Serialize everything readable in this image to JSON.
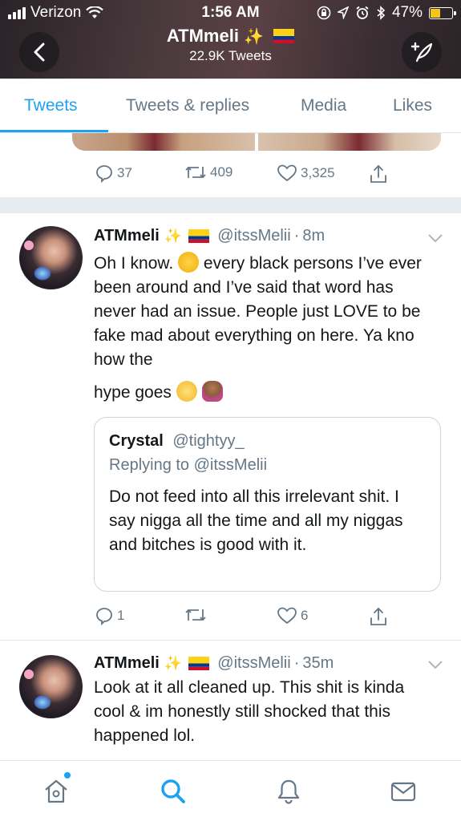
{
  "status_bar": {
    "carrier": "Verizon",
    "time": "1:56 AM",
    "battery_percent": "47%",
    "battery_level": 0.47,
    "battery_color": "#f5c518"
  },
  "header": {
    "name": "ATMmeli",
    "tweet_count": "22.9K Tweets",
    "back_icon": "chevron-left-icon",
    "compose_icon": "compose-feather-icon"
  },
  "tabs": [
    {
      "label": "Tweets",
      "active": true
    },
    {
      "label": "Tweets & replies",
      "active": false
    },
    {
      "label": "Media",
      "active": false
    },
    {
      "label": "Likes",
      "active": false
    }
  ],
  "colors": {
    "accent": "#1da1f2",
    "secondary_text": "#657786",
    "border": "#e1e8ed"
  },
  "previous_tweet": {
    "replies": "37",
    "retweets": "409",
    "likes": "3,325"
  },
  "tweets": [
    {
      "name": "ATMmeli",
      "handle": "@itssMelii",
      "time": "8m",
      "text_line1": "Oh I know.",
      "text_line1_rest": "every black persons I’ve ever been around and I’ve said that word has never had an issue. People just LOVE to be fake mad about everything on here. Ya kno how the",
      "text_end": "hype goes",
      "quote": {
        "name": "Crystal",
        "handle": "@tightyy_",
        "replying_to": "Replying to @itssMelii",
        "text": "Do not feed into all this irrelevant shit. I say nigga all the time and all my niggas and bitches is good with it."
      },
      "replies": "1",
      "retweets": "",
      "likes": "6"
    },
    {
      "name": "ATMmeli",
      "handle": "@itssMelii",
      "time": "35m",
      "text": "Look at it all cleaned up. This shit is kinda cool & im honestly still shocked that this happened lol."
    }
  ],
  "bottom_nav": [
    {
      "icon": "home-icon",
      "active": false,
      "has_notification_dot": true
    },
    {
      "icon": "search-icon",
      "active": true
    },
    {
      "icon": "bell-icon",
      "active": false
    },
    {
      "icon": "mail-icon",
      "active": false
    }
  ]
}
